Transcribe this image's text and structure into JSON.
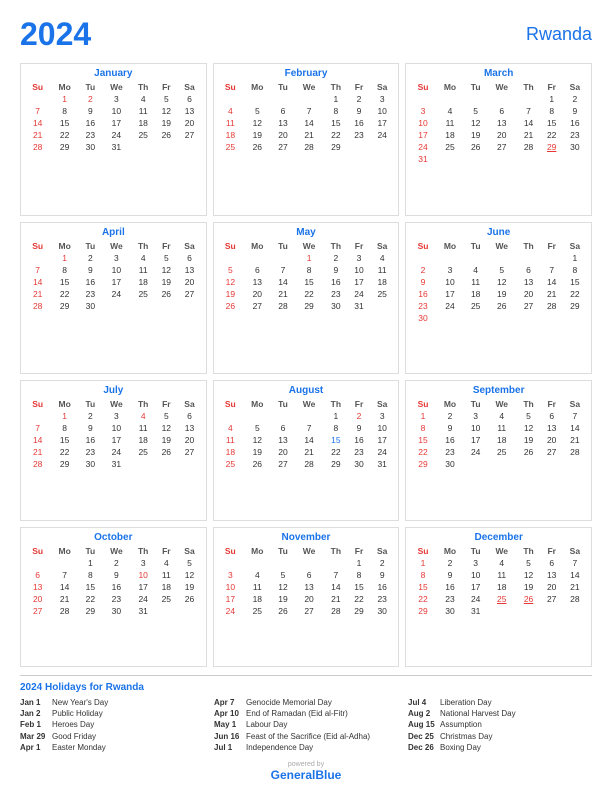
{
  "header": {
    "year": "2024",
    "country": "Rwanda"
  },
  "months": [
    {
      "name": "January",
      "days_of_week": [
        "Su",
        "Mo",
        "Tu",
        "We",
        "Th",
        "Fr",
        "Sa"
      ],
      "weeks": [
        [
          "",
          "1",
          "2",
          "3",
          "4",
          "5",
          "6"
        ],
        [
          "7",
          "8",
          "9",
          "10",
          "11",
          "12",
          "13"
        ],
        [
          "14",
          "15",
          "16",
          "17",
          "18",
          "19",
          "20"
        ],
        [
          "21",
          "22",
          "23",
          "24",
          "25",
          "26",
          "27"
        ],
        [
          "28",
          "29",
          "30",
          "31",
          "",
          "",
          ""
        ]
      ],
      "holidays": [
        "1",
        "2"
      ],
      "sundays": [
        "7",
        "14",
        "21",
        "28"
      ],
      "start_day": 1
    },
    {
      "name": "February",
      "days_of_week": [
        "Su",
        "Mo",
        "Tu",
        "We",
        "Th",
        "Fr",
        "Sa"
      ],
      "weeks": [
        [
          "",
          "",
          "",
          "",
          "1",
          "2",
          "3"
        ],
        [
          "4",
          "5",
          "6",
          "7",
          "8",
          "9",
          "10"
        ],
        [
          "11",
          "12",
          "13",
          "14",
          "15",
          "16",
          "17"
        ],
        [
          "18",
          "19",
          "20",
          "21",
          "22",
          "23",
          "24"
        ],
        [
          "25",
          "26",
          "27",
          "28",
          "29",
          "",
          ""
        ]
      ],
      "holidays": [],
      "sundays": [
        "4",
        "11",
        "18",
        "25"
      ]
    },
    {
      "name": "March",
      "days_of_week": [
        "Su",
        "Mo",
        "Tu",
        "We",
        "Th",
        "Fr",
        "Sa"
      ],
      "weeks": [
        [
          "",
          "",
          "",
          "",
          "",
          "1",
          "2"
        ],
        [
          "3",
          "4",
          "5",
          "6",
          "7",
          "8",
          "9"
        ],
        [
          "10",
          "11",
          "12",
          "13",
          "14",
          "15",
          "16"
        ],
        [
          "17",
          "18",
          "19",
          "20",
          "21",
          "22",
          "23"
        ],
        [
          "24",
          "25",
          "26",
          "27",
          "28",
          "29",
          "30"
        ],
        [
          "31",
          "",
          "",
          "",
          "",
          "",
          ""
        ]
      ],
      "holidays": [
        "29"
      ],
      "sundays": [
        "3",
        "10",
        "17",
        "24",
        "31"
      ]
    },
    {
      "name": "April",
      "days_of_week": [
        "Su",
        "Mo",
        "Tu",
        "We",
        "Th",
        "Fr",
        "Sa"
      ],
      "weeks": [
        [
          "",
          "1",
          "2",
          "3",
          "4",
          "5",
          "6"
        ],
        [
          "7",
          "8",
          "9",
          "10",
          "11",
          "12",
          "13"
        ],
        [
          "14",
          "15",
          "16",
          "17",
          "18",
          "19",
          "20"
        ],
        [
          "21",
          "22",
          "23",
          "24",
          "25",
          "26",
          "27"
        ],
        [
          "28",
          "29",
          "30",
          "",
          "",
          "",
          ""
        ]
      ],
      "holidays": [
        "1",
        "7"
      ],
      "sundays": [
        "7",
        "14",
        "21",
        "28"
      ]
    },
    {
      "name": "May",
      "days_of_week": [
        "Su",
        "Mo",
        "Tu",
        "We",
        "Th",
        "Fr",
        "Sa"
      ],
      "weeks": [
        [
          "",
          "",
          "",
          "1",
          "2",
          "3",
          "4"
        ],
        [
          "5",
          "6",
          "7",
          "8",
          "9",
          "10",
          "11"
        ],
        [
          "12",
          "13",
          "14",
          "15",
          "16",
          "17",
          "18"
        ],
        [
          "19",
          "20",
          "21",
          "22",
          "23",
          "24",
          "25"
        ],
        [
          "26",
          "27",
          "28",
          "29",
          "30",
          "31",
          ""
        ]
      ],
      "holidays": [
        "1"
      ],
      "sundays": [
        "5",
        "12",
        "19",
        "26"
      ]
    },
    {
      "name": "June",
      "days_of_week": [
        "Su",
        "Mo",
        "Tu",
        "We",
        "Th",
        "Fr",
        "Sa"
      ],
      "weeks": [
        [
          "",
          "",
          "",
          "",
          "",
          "",
          "1"
        ],
        [
          "2",
          "3",
          "4",
          "5",
          "6",
          "7",
          "8"
        ],
        [
          "9",
          "10",
          "11",
          "12",
          "13",
          "14",
          "15"
        ],
        [
          "16",
          "17",
          "18",
          "19",
          "20",
          "21",
          "22"
        ],
        [
          "23",
          "24",
          "25",
          "26",
          "27",
          "28",
          "29"
        ],
        [
          "30",
          "",
          "",
          "",
          "",
          "",
          ""
        ]
      ],
      "holidays": [
        "16"
      ],
      "sundays": [
        "2",
        "9",
        "16",
        "23",
        "30"
      ]
    },
    {
      "name": "July",
      "days_of_week": [
        "Su",
        "Mo",
        "Tu",
        "We",
        "Th",
        "Fr",
        "Sa"
      ],
      "weeks": [
        [
          "",
          "1",
          "2",
          "3",
          "4",
          "5",
          "6"
        ],
        [
          "7",
          "8",
          "9",
          "10",
          "11",
          "12",
          "13"
        ],
        [
          "14",
          "15",
          "16",
          "17",
          "18",
          "19",
          "20"
        ],
        [
          "21",
          "22",
          "23",
          "24",
          "25",
          "26",
          "27"
        ],
        [
          "28",
          "29",
          "30",
          "31",
          "",
          "",
          ""
        ]
      ],
      "holidays": [
        "1",
        "4"
      ],
      "sundays": [
        "7",
        "14",
        "21",
        "28"
      ]
    },
    {
      "name": "August",
      "days_of_week": [
        "Su",
        "Mo",
        "Tu",
        "We",
        "Th",
        "Fr",
        "Sa"
      ],
      "weeks": [
        [
          "",
          "",
          "",
          "",
          "1",
          "2",
          "3"
        ],
        [
          "4",
          "5",
          "6",
          "7",
          "8",
          "9",
          "10"
        ],
        [
          "11",
          "12",
          "13",
          "14",
          "15",
          "16",
          "17"
        ],
        [
          "18",
          "19",
          "20",
          "21",
          "22",
          "23",
          "24"
        ],
        [
          "25",
          "26",
          "27",
          "28",
          "29",
          "30",
          "31"
        ]
      ],
      "holidays": [
        "2",
        "15"
      ],
      "sundays": [
        "4",
        "11",
        "18",
        "25"
      ]
    },
    {
      "name": "September",
      "days_of_week": [
        "Su",
        "Mo",
        "Tu",
        "We",
        "Th",
        "Fr",
        "Sa"
      ],
      "weeks": [
        [
          "1",
          "2",
          "3",
          "4",
          "5",
          "6",
          "7"
        ],
        [
          "8",
          "9",
          "10",
          "11",
          "12",
          "13",
          "14"
        ],
        [
          "15",
          "16",
          "17",
          "18",
          "19",
          "20",
          "21"
        ],
        [
          "22",
          "23",
          "24",
          "25",
          "26",
          "27",
          "28"
        ],
        [
          "29",
          "30",
          "",
          "",
          "",
          "",
          ""
        ]
      ],
      "holidays": [],
      "sundays": [
        "1",
        "8",
        "15",
        "22",
        "29"
      ]
    },
    {
      "name": "October",
      "days_of_week": [
        "Su",
        "Mo",
        "Tu",
        "We",
        "Th",
        "Fr",
        "Sa"
      ],
      "weeks": [
        [
          "",
          "",
          "1",
          "2",
          "3",
          "4",
          "5"
        ],
        [
          "6",
          "7",
          "8",
          "9",
          "10",
          "11",
          "12"
        ],
        [
          "13",
          "14",
          "15",
          "16",
          "17",
          "18",
          "19"
        ],
        [
          "20",
          "21",
          "22",
          "23",
          "24",
          "25",
          "26"
        ],
        [
          "27",
          "28",
          "29",
          "30",
          "31",
          "",
          ""
        ]
      ],
      "holidays": [],
      "sundays": [
        "6",
        "13",
        "20",
        "27"
      ]
    },
    {
      "name": "November",
      "days_of_week": [
        "Su",
        "Mo",
        "Tu",
        "We",
        "Th",
        "Fr",
        "Sa"
      ],
      "weeks": [
        [
          "",
          "",
          "",
          "",
          "",
          "1",
          "2"
        ],
        [
          "3",
          "4",
          "5",
          "6",
          "7",
          "8",
          "9"
        ],
        [
          "10",
          "11",
          "12",
          "13",
          "14",
          "15",
          "16"
        ],
        [
          "17",
          "18",
          "19",
          "20",
          "21",
          "22",
          "23"
        ],
        [
          "24",
          "25",
          "26",
          "27",
          "28",
          "29",
          "30"
        ]
      ],
      "holidays": [],
      "sundays": [
        "3",
        "10",
        "17",
        "24"
      ]
    },
    {
      "name": "December",
      "days_of_week": [
        "Su",
        "Mo",
        "Tu",
        "We",
        "Th",
        "Fr",
        "Sa"
      ],
      "weeks": [
        [
          "1",
          "2",
          "3",
          "4",
          "5",
          "6",
          "7"
        ],
        [
          "8",
          "9",
          "10",
          "11",
          "12",
          "13",
          "14"
        ],
        [
          "15",
          "16",
          "17",
          "18",
          "19",
          "20",
          "21"
        ],
        [
          "22",
          "23",
          "24",
          "25",
          "26",
          "27",
          "28"
        ],
        [
          "29",
          "30",
          "31",
          "",
          "",
          "",
          ""
        ]
      ],
      "holidays": [
        "25",
        "26"
      ],
      "sundays": [
        "1",
        "8",
        "15",
        "22",
        "29"
      ]
    }
  ],
  "holidays_title": "2024 Holidays for Rwanda",
  "holidays_col1": [
    {
      "date": "Jan 1",
      "name": "New Year's Day"
    },
    {
      "date": "Jan 2",
      "name": "Public Holiday"
    },
    {
      "date": "Feb 1",
      "name": "Heroes Day"
    },
    {
      "date": "Mar 29",
      "name": "Good Friday"
    },
    {
      "date": "Apr 1",
      "name": "Easter Monday"
    }
  ],
  "holidays_col2": [
    {
      "date": "Apr 7",
      "name": "Genocide Memorial Day"
    },
    {
      "date": "Apr 10",
      "name": "End of Ramadan (Eid al-Fitr)"
    },
    {
      "date": "May 1",
      "name": "Labour Day"
    },
    {
      "date": "Jun 16",
      "name": "Feast of the Sacrifice (Eid al-Adha)"
    },
    {
      "date": "Jul 1",
      "name": "Independence Day"
    }
  ],
  "holidays_col3": [
    {
      "date": "Jul 4",
      "name": "Liberation Day"
    },
    {
      "date": "Aug 2",
      "name": "National Harvest Day"
    },
    {
      "date": "Aug 15",
      "name": "Assumption"
    },
    {
      "date": "Dec 25",
      "name": "Christmas Day"
    },
    {
      "date": "Dec 26",
      "name": "Boxing Day"
    }
  ],
  "footer": {
    "powered": "powered by",
    "brand_general": "General",
    "brand_blue": "Blue"
  }
}
